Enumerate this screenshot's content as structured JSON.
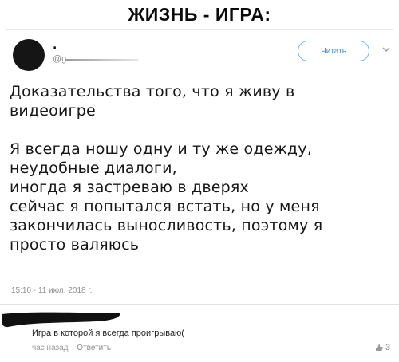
{
  "headline": "ЖИЗНЬ - ИГРА:",
  "tweet": {
    "author_name": ".",
    "handle": "@g",
    "read_button_label": "Читать",
    "paragraph1": "Доказательства того, что я живу в видеоигре",
    "lines": [
      "Я всегда ношу одну и ту же одежду,",
      "неудобные диалоги,",
      "иногда я застреваю в дверях",
      "сейчас я попытался встать, но у меня",
      "закончилась выносливость, поэтому я",
      "просто валяюсь"
    ],
    "timestamp": "15:10 - 11 июл. 2018 г."
  },
  "reply": {
    "text": "Игра в которой я всегда проигрываю(",
    "time": "час назад",
    "reply_label": "Ответить",
    "likes": "3"
  },
  "colors": {
    "accent": "#3a8bd8",
    "text": "#161616",
    "muted": "#8f8f8f"
  }
}
